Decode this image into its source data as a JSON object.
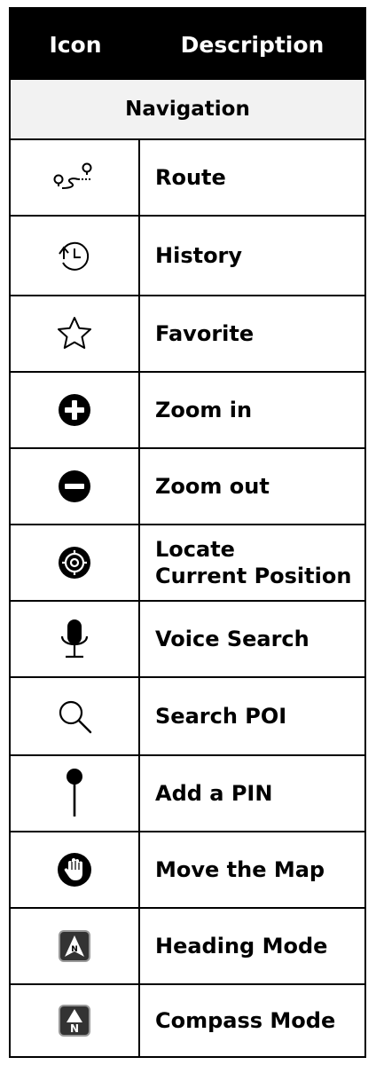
{
  "header": {
    "icon_label": "Icon",
    "description_label": "Description"
  },
  "section": {
    "title": "Navigation"
  },
  "rows": [
    {
      "icon": "route-icon",
      "label": "Route"
    },
    {
      "icon": "history-icon",
      "label": "History"
    },
    {
      "icon": "star-outline-icon",
      "label": "Favorite"
    },
    {
      "icon": "plus-circle-icon",
      "label": "Zoom in"
    },
    {
      "icon": "minus-circle-icon",
      "label": "Zoom out"
    },
    {
      "icon": "crosshair-icon",
      "label": "Locate\nCurrent Position"
    },
    {
      "icon": "microphone-icon",
      "label": "Voice Search"
    },
    {
      "icon": "magnifier-icon",
      "label": "Search POI"
    },
    {
      "icon": "pin-icon",
      "label": "Add a PIN"
    },
    {
      "icon": "hand-icon",
      "label": "Move the Map"
    },
    {
      "icon": "heading-mode-icon",
      "label": "Heading Mode"
    },
    {
      "icon": "compass-mode-icon",
      "label": "Compass Mode"
    }
  ]
}
